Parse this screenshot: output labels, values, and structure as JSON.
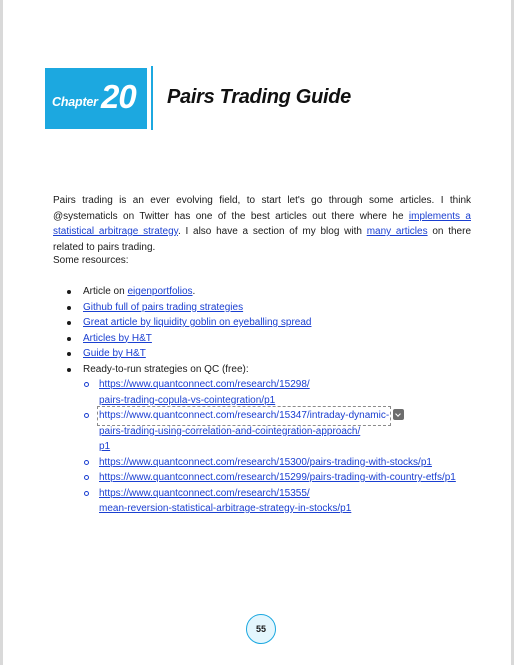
{
  "header": {
    "chapter_word": "Chapter",
    "chapter_number": "20",
    "title": "Pairs Trading Guide"
  },
  "intro": {
    "text_1": "Pairs trading is an ever evolving field, to start let's go through some articles. I think @systematicls on Twitter has one of the best articles out there where he ",
    "link_1": "implements a statistical arbitrage strategy",
    "text_2": ". I also have a section of my blog with ",
    "link_2": "many articles",
    "text_3": " on there related to pairs trading."
  },
  "resources_heading": "Some resources:",
  "resources": {
    "item_1_prefix": "Article on ",
    "item_1_link": "eigenportfolios",
    "item_1_suffix": ".",
    "item_2_link": "Github full of pairs trading strategies",
    "item_3_link": "Great article by liquidity goblin on eyeballing spread",
    "item_4_link": "Articles by H&T",
    "item_5_link": "Guide by H&T",
    "item_6_text": "Ready-to-run strategies on QC (free):",
    "qc_links": {
      "l1_a": "https://www.quantconnect.com/research/15298/",
      "l1_b": "pairs-trading-copula-vs-cointegration/p1",
      "l2_a": "https://www.quantconnect.com/research/15347/intraday-dynamic-",
      "l2_b": "pairs-trading-using-correlation-and-cointegration-approach/",
      "l2_c": "p1",
      "l3": "https://www.quantconnect.com/research/15300/pairs-trading-with-stocks/p1",
      "l4": "https://www.quantconnect.com/research/15299/pairs-trading-with-country-etfs/p1",
      "l5_a": "https://www.quantconnect.com/research/15355/",
      "l5_b": "mean-reversion-statistical-arbitrage-strategy-in-stocks/p1"
    }
  },
  "footer": {
    "page_number": "55"
  },
  "colors": {
    "accent": "#1ca8e0",
    "link": "#1a3fd1",
    "text": "#1a1a1a"
  },
  "icons": {
    "dropdown": "chevron-down-icon"
  }
}
